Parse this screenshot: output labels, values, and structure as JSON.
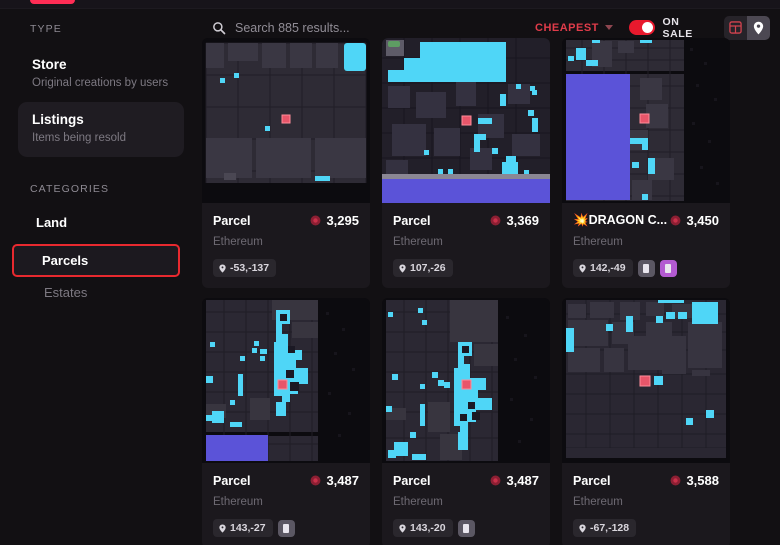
{
  "colors": {
    "accent": "#e8192d",
    "sort_accent": "#e03c4a",
    "highlight_border": "#e8292f",
    "page_bg": "#121013",
    "card_bg": "#1b181d",
    "map_cyan": "#4fd6f7",
    "map_purple": "#5b53d8",
    "map_selected": "#e8566a",
    "badge_purple": "#b35ad1"
  },
  "topnav": {
    "active_indicator": "nav-active-pill"
  },
  "sidebar": {
    "type_label": "TYPE",
    "type_items": [
      {
        "title": "Store",
        "subtitle": "Original creations by users",
        "selected": false
      },
      {
        "title": "Listings",
        "subtitle": "Items being resold",
        "selected": true
      }
    ],
    "categories_label": "CATEGORIES",
    "categories": [
      {
        "label": "Land",
        "level": "parent",
        "active": false
      },
      {
        "label": "Parcels",
        "level": "child",
        "active": true
      },
      {
        "label": "Estates",
        "level": "child",
        "active": false
      }
    ]
  },
  "toolbar": {
    "search_placeholder": "Search 885 results...",
    "search_value": "",
    "search_icon": "search-icon",
    "sort_label": "CHEAPEST",
    "sort_icon": "chevron-down-icon",
    "on_sale_label": "ON SALE",
    "on_sale_enabled": true,
    "views": [
      {
        "name": "grid-view-button",
        "icon": "grid-icon",
        "active": false
      },
      {
        "name": "map-view-button",
        "icon": "map-pin-icon",
        "active": true
      }
    ]
  },
  "results": {
    "count": 885,
    "cards": [
      {
        "title": "Parcel",
        "price": "3,295",
        "network": "Ethereum",
        "coords": "-53,-137",
        "badges": []
      },
      {
        "title": "Parcel",
        "price": "3,369",
        "network": "Ethereum",
        "coords": "107,-26",
        "badges": []
      },
      {
        "title": "💥DRAGON C...",
        "price": "3,450",
        "network": "Ethereum",
        "coords": "142,-49",
        "badges": [
          "gray",
          "purple"
        ]
      },
      {
        "title": "Parcel",
        "price": "3,487",
        "network": "Ethereum",
        "coords": "143,-27",
        "badges": [
          "gray"
        ]
      },
      {
        "title": "Parcel",
        "price": "3,487",
        "network": "Ethereum",
        "coords": "143,-20",
        "badges": [
          "gray"
        ]
      },
      {
        "title": "Parcel",
        "price": "3,588",
        "network": "Ethereum",
        "coords": "-67,-128",
        "badges": []
      }
    ]
  }
}
